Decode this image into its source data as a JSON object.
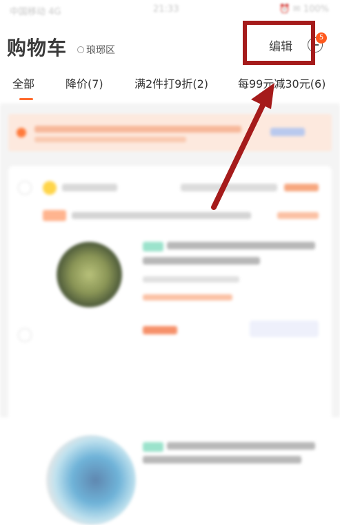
{
  "status_bar": {
    "left": "中国移动 4G",
    "time": "21:33",
    "right": "⏰ ✉ 100%"
  },
  "header": {
    "title": "购物车",
    "location": "琅琊区",
    "edit_label": "编辑",
    "message_badge": "5"
  },
  "tabs": [
    {
      "label": "全部",
      "active": true
    },
    {
      "label": "降价(7)"
    },
    {
      "label": "满2件打9折(2)"
    },
    {
      "label": "每99元减30元(6)"
    }
  ],
  "colors": {
    "accent": "#ff6a2c",
    "annotation": "#a51b1b",
    "badge": "#ff5a1f"
  },
  "icons": {
    "location": "location-pin-icon",
    "message": "message-icon"
  }
}
